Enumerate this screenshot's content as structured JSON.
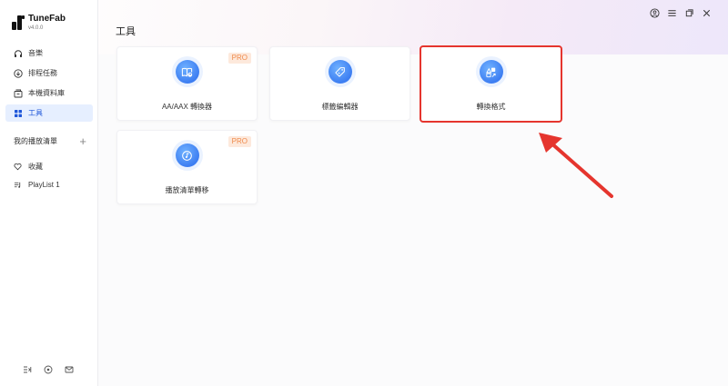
{
  "app": {
    "name": "TuneFab",
    "version": "v4.0.0"
  },
  "sidebar": {
    "items": [
      {
        "label": "音樂",
        "icon": "headphones-icon"
      },
      {
        "label": "排程任務",
        "icon": "download-circle-icon"
      },
      {
        "label": "本機資料庫",
        "icon": "folder-box-icon"
      },
      {
        "label": "工具",
        "icon": "grid-icon"
      }
    ],
    "playlists_header": "我的播放清單",
    "playlists": [
      {
        "label": "收藏",
        "icon": "heart-icon"
      },
      {
        "label": "PlayList 1",
        "icon": "playlist-icon"
      }
    ]
  },
  "main": {
    "title": "工具",
    "tools": [
      {
        "label": "AA/AAX 轉換器",
        "badge": "PRO",
        "icon": "book-convert-icon"
      },
      {
        "label": "標籤編輯器",
        "badge": "",
        "icon": "tag-icon"
      },
      {
        "label": "轉換格式",
        "badge": "",
        "icon": "format-convert-icon"
      },
      {
        "label": "播放清單轉移",
        "badge": "PRO",
        "icon": "playlist-transfer-icon"
      }
    ]
  },
  "colors": {
    "accent": "#1e56d9",
    "highlight": "#e5352e",
    "pro_badge": "#ef8a4b"
  }
}
